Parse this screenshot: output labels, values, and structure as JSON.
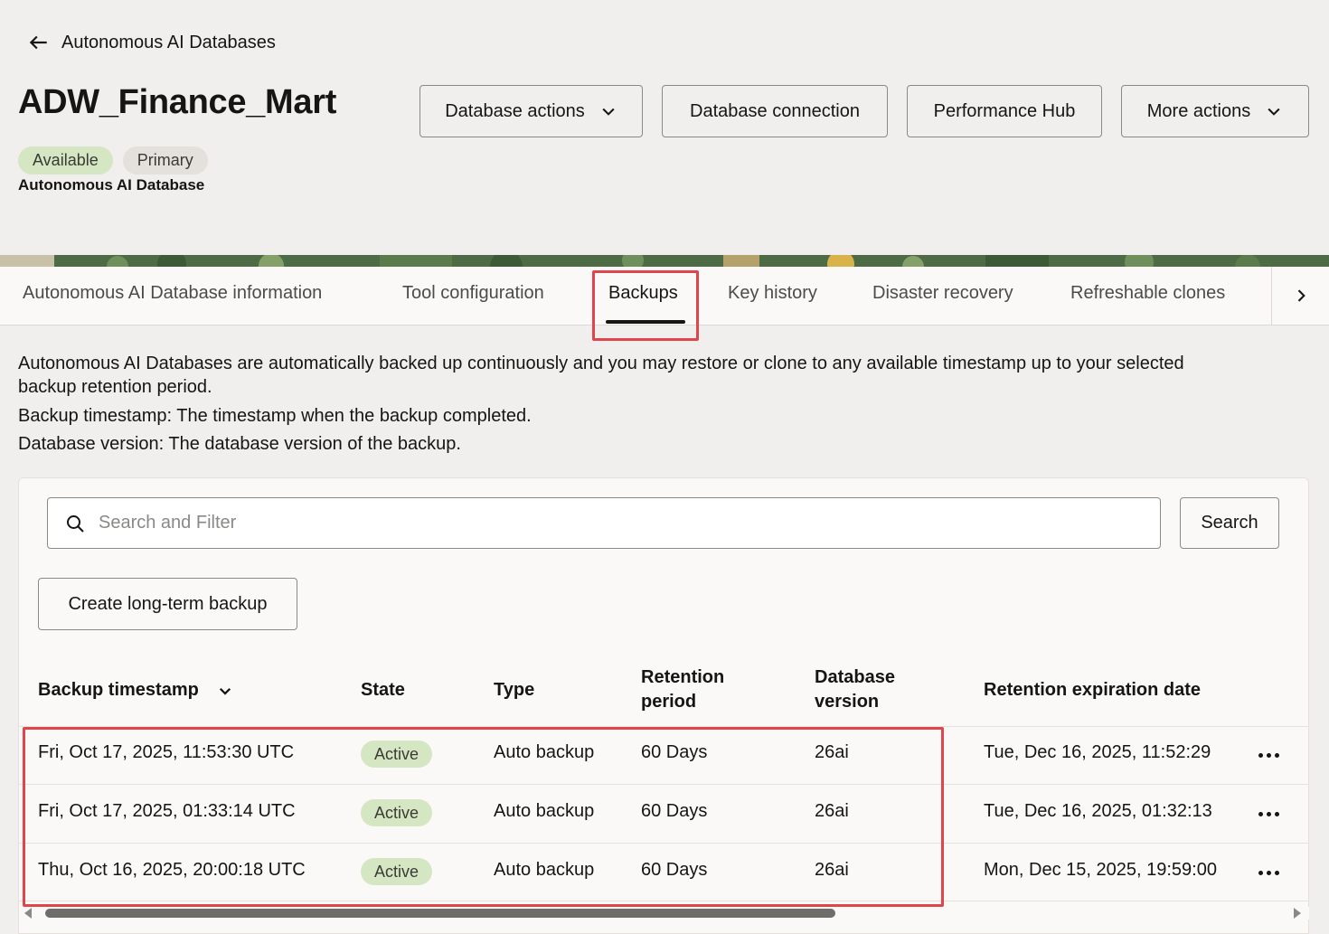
{
  "header": {
    "back_label": "Autonomous AI Databases",
    "title": "ADW_Finance_Mart",
    "badges": [
      "Available",
      "Primary"
    ],
    "subtitle": "Autonomous AI Database",
    "buttons": {
      "database_actions": "Database actions",
      "database_connection": "Database connection",
      "performance_hub": "Performance Hub",
      "more_actions": "More actions"
    }
  },
  "tabs": [
    {
      "label": "Autonomous AI Database information",
      "active": false
    },
    {
      "label": "Tool configuration",
      "active": false
    },
    {
      "label": "Backups",
      "active": true
    },
    {
      "label": "Key history",
      "active": false
    },
    {
      "label": "Disaster recovery",
      "active": false
    },
    {
      "label": "Refreshable clones",
      "active": false
    }
  ],
  "description": {
    "line1": "Autonomous AI Databases are automatically backed up continuously and you may restore or clone to any available timestamp up to your selected",
    "line1b": "backup retention period.",
    "line2": "Backup timestamp: The timestamp when the backup completed.",
    "line3": "Database version: The database version of the backup."
  },
  "search": {
    "placeholder": "Search and Filter",
    "button": "Search"
  },
  "create_button": "Create long-term backup",
  "table": {
    "headers": {
      "timestamp": "Backup timestamp",
      "state": "State",
      "type": "Type",
      "retention_line1": "Retention",
      "retention_line2": "period",
      "version_line1": "Database",
      "version_line2": "version",
      "expiration": "Retention expiration date"
    },
    "rows": [
      {
        "timestamp": "Fri, Oct 17, 2025, 11:53:30 UTC",
        "state": "Active",
        "type": "Auto backup",
        "retention": "60 Days",
        "version": "26ai",
        "expiration": "Tue, Dec 16, 2025, 11:52:29"
      },
      {
        "timestamp": "Fri, Oct 17, 2025, 01:33:14 UTC",
        "state": "Active",
        "type": "Auto backup",
        "retention": "60 Days",
        "version": "26ai",
        "expiration": "Tue, Dec 16, 2025, 01:32:13"
      },
      {
        "timestamp": "Thu, Oct 16, 2025, 20:00:18 UTC",
        "state": "Active",
        "type": "Auto backup",
        "retention": "60 Days",
        "version": "26ai",
        "expiration": "Mon, Dec 15, 2025, 19:59:00"
      }
    ]
  },
  "colors": {
    "background": "#f1efed",
    "available_badge": "#d4e7c2",
    "highlight": "#e0454b"
  },
  "icons": {
    "back": "arrow-left-icon",
    "dropdown": "chevron-down-icon",
    "tabs_next": "chevron-right-icon",
    "search": "search-icon",
    "row_actions": "more-horizontal-icon"
  }
}
